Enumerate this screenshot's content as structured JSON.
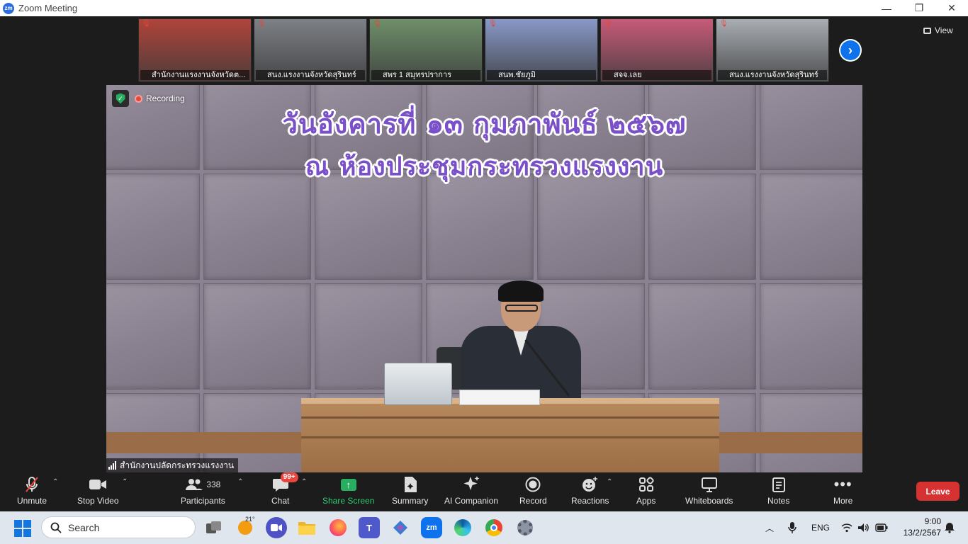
{
  "window": {
    "title": "Zoom Meeting",
    "minimize": "—",
    "maximize": "❐",
    "close": "✕"
  },
  "filmstrip": {
    "participants": [
      {
        "name": "สำนักงานแรงงานจังหวัดต...",
        "bg": "#b0443a"
      },
      {
        "name": "สนง.แรงงานจังหวัดสุรินทร์",
        "bg": "#7d8086"
      },
      {
        "name": "สพร 1 สมุทรปราการ",
        "bg": "#6f8f6a"
      },
      {
        "name": "สนพ.ชัยภูมิ",
        "bg": "#8898c8"
      },
      {
        "name": "สจจ.เลย",
        "bg": "#c85a78"
      },
      {
        "name": "สนง.แรงงานจังหวัดสุรินทร์",
        "bg": "#a9aeb4"
      }
    ],
    "view_label": "View"
  },
  "main_video": {
    "banner_line1": "วันอังคารที่ ๑๓ กุมภาพันธ์ ๒๕๖๗",
    "banner_line2": "ณ ห้องประชุมกระทรวงแรงงาน",
    "recording_label": "Recording",
    "speaker_name": "สำนักงานปลัดกระทรวงแรงงาน"
  },
  "toolbar": {
    "unmute": "Unmute",
    "stop_video": "Stop Video",
    "participants": "Participants",
    "participants_count": "338",
    "chat": "Chat",
    "chat_badge": "99+",
    "share_screen": "Share Screen",
    "summary": "Summary",
    "ai_companion": "AI Companion",
    "record": "Record",
    "reactions": "Reactions",
    "apps": "Apps",
    "whiteboards": "Whiteboards",
    "notes": "Notes",
    "more": "More",
    "leave": "Leave"
  },
  "taskbar": {
    "search_placeholder": "Search",
    "weather_temp": "21°",
    "language": "ENG",
    "time": "9:00",
    "date": "13/2/2567"
  },
  "colors": {
    "accent_blue": "#0e72ed",
    "share_green": "#27ae60",
    "leave_red": "#d63232",
    "banner_purple": "#7a50c8"
  }
}
